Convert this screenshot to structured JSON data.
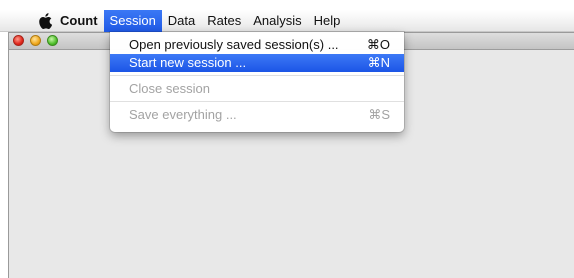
{
  "menubar": {
    "app_name": "Count",
    "items": [
      "Session",
      "Data",
      "Rates",
      "Analysis",
      "Help"
    ],
    "active": "Session"
  },
  "session_menu": {
    "items": [
      {
        "label": "Open previously saved session(s) ...",
        "shortcut": "⌘O",
        "enabled": true,
        "highlighted": false
      },
      {
        "label": "Start new session ...",
        "shortcut": "⌘N",
        "enabled": true,
        "highlighted": true
      },
      {
        "label": "Close session",
        "shortcut": "",
        "enabled": false,
        "highlighted": false
      },
      {
        "label": "Save everything ...",
        "shortcut": "⌘S",
        "enabled": false,
        "highlighted": false
      }
    ]
  },
  "colors": {
    "accent": "#2a63ee",
    "window_bg": "#e8e8e8"
  }
}
